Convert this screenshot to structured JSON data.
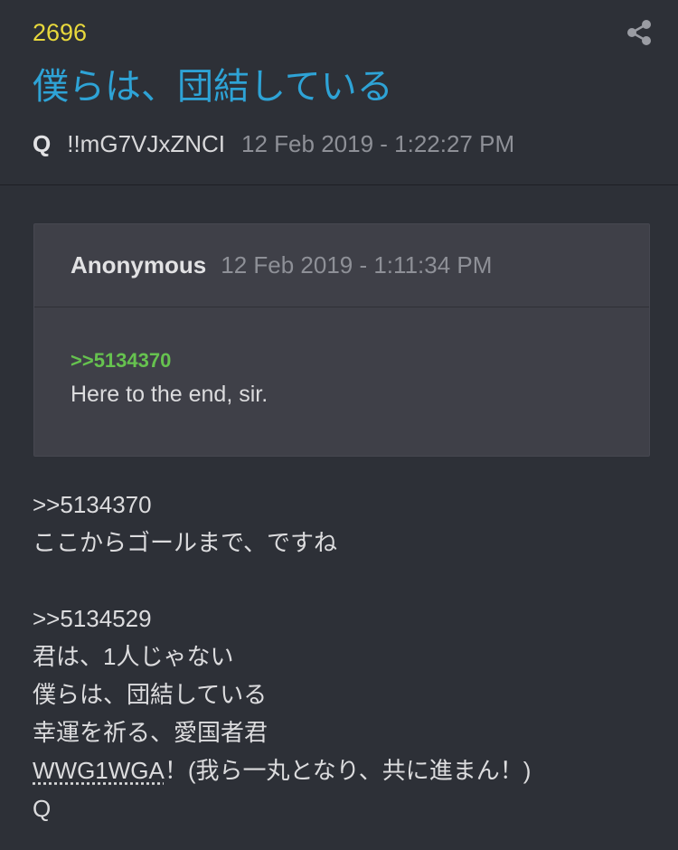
{
  "post": {
    "number": "2696",
    "title": "僕らは、団結している",
    "author": "Q",
    "tripcode": "!!mG7VJxZNCI",
    "timestamp": "12 Feb 2019 - 1:22:27 PM",
    "share_icon": "share-icon"
  },
  "quoted": {
    "author": "Anonymous",
    "timestamp": "12 Feb 2019 - 1:11:34 PM",
    "reference": ">>5134370",
    "text": "Here to the end, sir."
  },
  "body": {
    "line1": ">>5134370",
    "line2": "ここからゴールまで、ですね",
    "line3": ">>5134529",
    "line4": "君は、1人じゃない",
    "line5": "僕らは、団結している",
    "line6": "幸運を祈る、愛国者君",
    "line7_abbr": "WWG1WGA",
    "line7_rest": "！(我ら一丸となり、共に進まん！)",
    "line8": "Q"
  },
  "colors": {
    "background": "#2d3037",
    "post_number": "#e8d83c",
    "title": "#2ea3d6",
    "quote_link": "#66c24f",
    "quoted_box": "#3f4048"
  }
}
